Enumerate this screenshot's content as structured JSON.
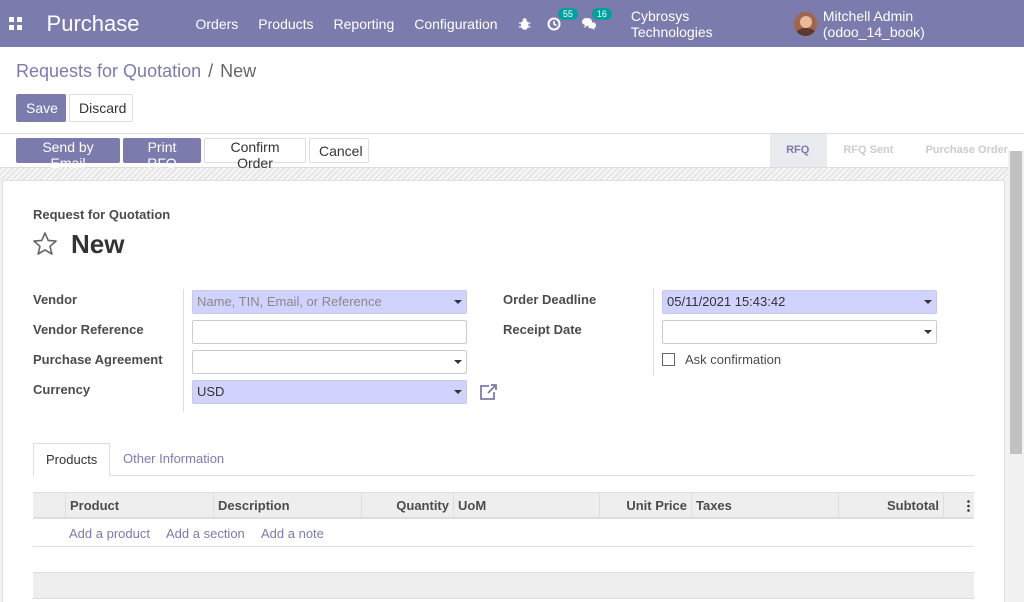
{
  "navbar": {
    "brand": "Purchase",
    "menu": [
      "Orders",
      "Products",
      "Reporting",
      "Configuration"
    ],
    "activities_count": "55",
    "messages_count": "16",
    "company": "Cybrosys Technologies",
    "user": "Mitchell Admin (odoo_14_book)"
  },
  "breadcrumb": {
    "parent": "Requests for Quotation",
    "separator": "/",
    "current": "New"
  },
  "buttons": {
    "save": "Save",
    "discard": "Discard",
    "send_email": "Send by Email",
    "print_rfq": "Print RFQ",
    "confirm_order": "Confirm Order",
    "cancel": "Cancel"
  },
  "stages": [
    "RFQ",
    "RFQ Sent",
    "Purchase Order"
  ],
  "form": {
    "subtitle": "Request for Quotation",
    "title": "New",
    "vendor_label": "Vendor",
    "vendor_placeholder": "Name, TIN, Email, or Reference",
    "vendor_ref_label": "Vendor Reference",
    "agreement_label": "Purchase Agreement",
    "currency_label": "Currency",
    "currency_value": "USD",
    "deadline_label": "Order Deadline",
    "deadline_value": "05/11/2021 15:43:42",
    "receipt_label": "Receipt Date",
    "ask_confirmation": "Ask confirmation"
  },
  "tabs": [
    "Products",
    "Other Information"
  ],
  "table": {
    "columns": [
      "Product",
      "Description",
      "Quantity",
      "UoM",
      "Unit Price",
      "Taxes",
      "Subtotal"
    ],
    "add_links": [
      "Add a product",
      "Add a section",
      "Add a note"
    ]
  },
  "colors": {
    "primary": "#7c7bad",
    "required_bg": "#d2d2ff"
  }
}
